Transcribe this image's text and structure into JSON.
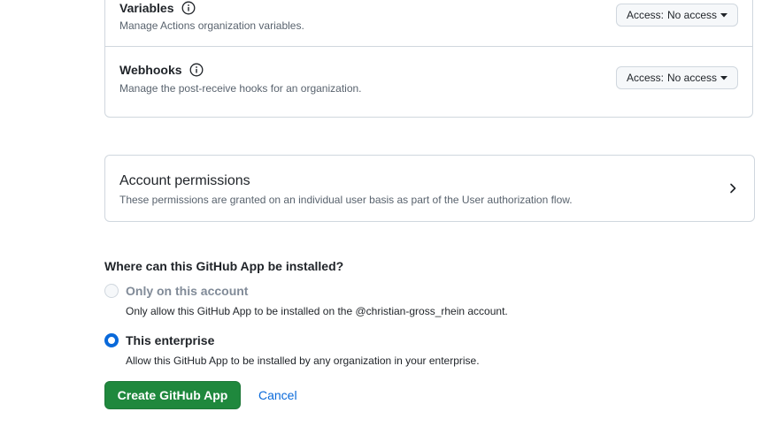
{
  "permissions": [
    {
      "title": "Variables",
      "description": "Manage Actions organization variables.",
      "access_prefix": "Access:",
      "access_value": "No access"
    },
    {
      "title": "Webhooks",
      "description": "Manage the post-receive hooks for an organization.",
      "access_prefix": "Access:",
      "access_value": "No access"
    }
  ],
  "account_permissions": {
    "title": "Account permissions",
    "description": "These permissions are granted on an individual user basis as part of the User authorization flow."
  },
  "install": {
    "question": "Where can this GitHub App be installed?",
    "options": [
      {
        "label": "Only on this account",
        "description": "Only allow this GitHub App to be installed on the @christian-gross_rhein account.",
        "selected": false,
        "disabled": true
      },
      {
        "label": "This enterprise",
        "description": "Allow this GitHub App to be installed by any organization in your enterprise.",
        "selected": true,
        "disabled": false
      }
    ]
  },
  "actions": {
    "create_label": "Create GitHub App",
    "cancel_label": "Cancel"
  },
  "colors": {
    "primary_button": "#1f883d",
    "link": "#0969da",
    "border": "#d0d7de",
    "muted_text": "#59636e"
  },
  "icons": {
    "info": "info-icon",
    "dropdown": "triangle-down-icon",
    "chevron": "chevron-right-icon"
  }
}
